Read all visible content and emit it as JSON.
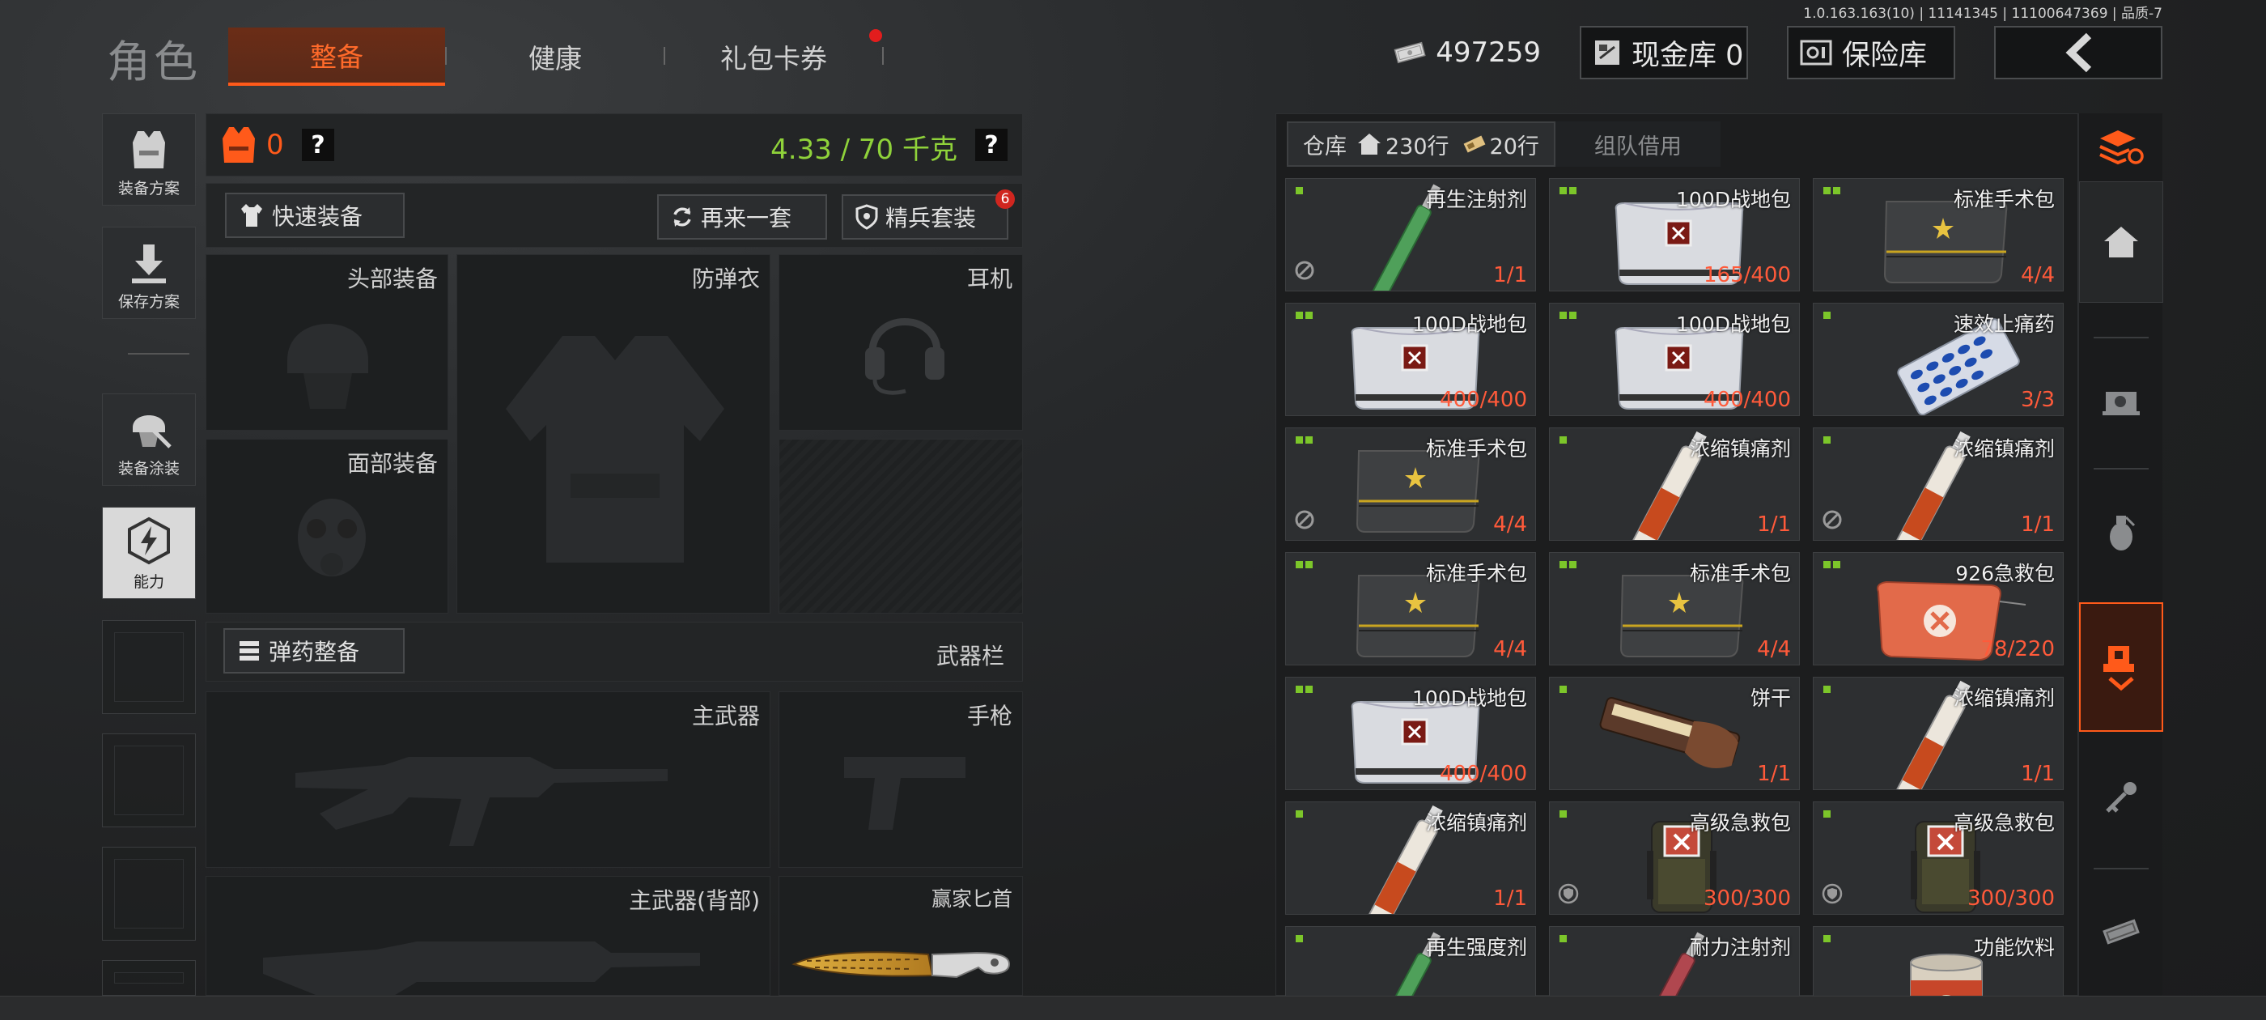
{
  "version_text": "1.0.163.163(10) | 11141345 | 11100647369 | 品质-7",
  "page_title": "角色",
  "tabs": [
    {
      "label": "整备",
      "active": true
    },
    {
      "label": "健康",
      "active": false
    },
    {
      "label": "礼包卡券",
      "active": false
    }
  ],
  "currency": "497259",
  "cash_vault": "现金库 0",
  "safe_vault": "保险库",
  "sidebar": {
    "items": [
      "装备方案",
      "保存方案",
      "装备涂装",
      "能力"
    ]
  },
  "loadout": {
    "armor_count": "0",
    "weight": "4.33 / 70 千克",
    "help_glyph": "?",
    "quick_equip": "快速装备",
    "repeat_set": "再来一套",
    "elite_set": "精兵套装",
    "elite_badge": "6",
    "slots": {
      "head": "头部装备",
      "vest": "防弹衣",
      "ear": "耳机",
      "face": "面部装备",
      "ammo": "弹药整备",
      "weapons_bar": "武器栏",
      "primary": "主武器",
      "pistol": "手枪",
      "primary_back": "主武器(背部)",
      "knife": "赢家匕首"
    }
  },
  "inventory": {
    "tab_warehouse": "仓库",
    "rows_main": "230行",
    "rows_ext": "20行",
    "tab_team": "组队借用",
    "items": [
      {
        "name": "再生注射剂",
        "qty": "1/1",
        "pips": 1,
        "icon": "syringe-green",
        "corner": "no-entry-icon"
      },
      {
        "name": "100D战地包",
        "qty": "165/400",
        "pips": 2,
        "icon": "bag-white",
        "corner": ""
      },
      {
        "name": "标准手术包",
        "qty": "4/4",
        "pips": 2,
        "icon": "bag-dark",
        "corner": ""
      },
      {
        "name": "100D战地包",
        "qty": "400/400",
        "pips": 2,
        "icon": "bag-white",
        "corner": ""
      },
      {
        "name": "100D战地包",
        "qty": "400/400",
        "pips": 2,
        "icon": "bag-white",
        "corner": ""
      },
      {
        "name": "速效止痛药",
        "qty": "3/3",
        "pips": 1,
        "icon": "pills",
        "corner": ""
      },
      {
        "name": "标准手术包",
        "qty": "4/4",
        "pips": 2,
        "icon": "bag-dark",
        "corner": "no-entry-icon"
      },
      {
        "name": "浓缩镇痛剂",
        "qty": "1/1",
        "pips": 1,
        "icon": "tube",
        "corner": ""
      },
      {
        "name": "浓缩镇痛剂",
        "qty": "1/1",
        "pips": 1,
        "icon": "tube",
        "corner": "no-entry-icon"
      },
      {
        "name": "标准手术包",
        "qty": "4/4",
        "pips": 2,
        "icon": "bag-dark",
        "corner": ""
      },
      {
        "name": "标准手术包",
        "qty": "4/4",
        "pips": 2,
        "icon": "bag-dark",
        "corner": ""
      },
      {
        "name": "926急救包",
        "qty": "78/220",
        "pips": 2,
        "icon": "pouch-orange",
        "corner": ""
      },
      {
        "name": "100D战地包",
        "qty": "400/400",
        "pips": 2,
        "icon": "bag-white",
        "corner": ""
      },
      {
        "name": "饼干",
        "qty": "1/1",
        "pips": 1,
        "icon": "biscuit",
        "corner": ""
      },
      {
        "name": "浓缩镇痛剂",
        "qty": "1/1",
        "pips": 1,
        "icon": "tube",
        "corner": ""
      },
      {
        "name": "浓缩镇痛剂",
        "qty": "1/1",
        "pips": 1,
        "icon": "tube",
        "corner": ""
      },
      {
        "name": "高级急救包",
        "qty": "300/300",
        "pips": 1,
        "icon": "backpack",
        "corner": "shield-icon"
      },
      {
        "name": "高级急救包",
        "qty": "300/300",
        "pips": 1,
        "icon": "backpack",
        "corner": "shield-icon"
      },
      {
        "name": "再生强度剂",
        "qty": "",
        "pips": 1,
        "icon": "syringe-green",
        "corner": ""
      },
      {
        "name": "耐力注射剂",
        "qty": "",
        "pips": 1,
        "icon": "syringe-red",
        "corner": ""
      },
      {
        "name": "功能饮料",
        "qty": "",
        "pips": 1,
        "icon": "can",
        "corner": ""
      }
    ]
  },
  "colors": {
    "accent": "#ff5a1a",
    "weight_ok": "#8fd23a",
    "qty": "#ff5a3a",
    "pip": "#7cc62a"
  }
}
